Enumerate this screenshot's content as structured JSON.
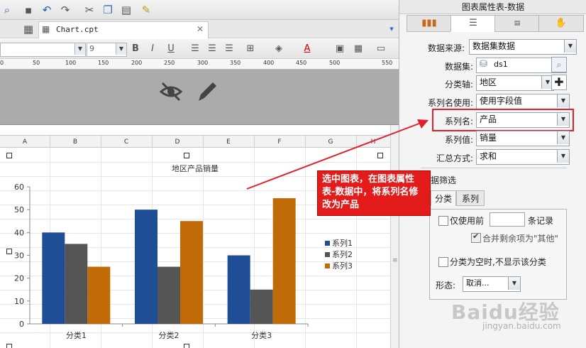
{
  "toolbar": {
    "icons": [
      "save-icon",
      "undo-icon",
      "redo-icon",
      "cut-icon",
      "copy-icon",
      "paste-icon",
      "brush-icon"
    ]
  },
  "file_tab": {
    "label": "Chart.cpt"
  },
  "format": {
    "font_size": "9",
    "bold": "B",
    "italic": "I",
    "underline": "U"
  },
  "ruler": {
    "ticks": [
      "0",
      "50",
      "100",
      "150",
      "200",
      "250",
      "300",
      "350",
      "400",
      "450",
      "500",
      "550"
    ]
  },
  "columns": [
    "A",
    "B",
    "C",
    "D",
    "E",
    "F",
    "G",
    "H"
  ],
  "chart_data": {
    "type": "bar",
    "title": "地区产品销量",
    "categories": [
      "分类1",
      "分类2",
      "分类3"
    ],
    "series": [
      {
        "name": "系列1",
        "values": [
          40,
          50,
          30
        ],
        "color": "#1f4e96"
      },
      {
        "name": "系列2",
        "values": [
          35,
          25,
          15
        ],
        "color": "#555555"
      },
      {
        "name": "系列3",
        "values": [
          25,
          45,
          55
        ],
        "color": "#c06a08"
      }
    ],
    "ylim": [
      0,
      60
    ],
    "yticks": [
      "0",
      "10",
      "20",
      "30",
      "40",
      "50",
      "60"
    ],
    "legend": "right",
    "grid": false
  },
  "right_panel": {
    "title": "图表属性表-数据",
    "fields": {
      "data_source_label": "数据来源:",
      "data_source_value": "数据集数据",
      "dataset_label": "数据集:",
      "dataset_value": "ds1",
      "category_axis_label": "分类轴:",
      "category_axis_value": "地区",
      "series_name_use_label": "系列名使用:",
      "series_name_use_value": "使用字段值",
      "series_name_label": "系列名:",
      "series_name_value": "产品",
      "series_value_label": "系列值:",
      "series_value_value": "销量",
      "summary_label": "汇总方式:",
      "summary_value": "求和"
    },
    "filter": {
      "section_label": "据筛选",
      "tab_category": "分类",
      "tab_series": "系列",
      "only_first_label": "仅使用前",
      "records_label": "条记录",
      "merge_label": "合并剩余项为\"其他\"",
      "hide_empty_label": "分类为空时,不显示该分类",
      "shape_label": "形态:",
      "shape_value": "取消..."
    }
  },
  "callout": {
    "text": "选中图表，在图表属性表-数据中，将系列名修改为产品"
  },
  "watermark": {
    "logo": "Baidu经验",
    "url": "jingyan.baidu.com"
  },
  "colors": {
    "highlight": "#e0202a",
    "callout_bg": "#e41b1b"
  }
}
